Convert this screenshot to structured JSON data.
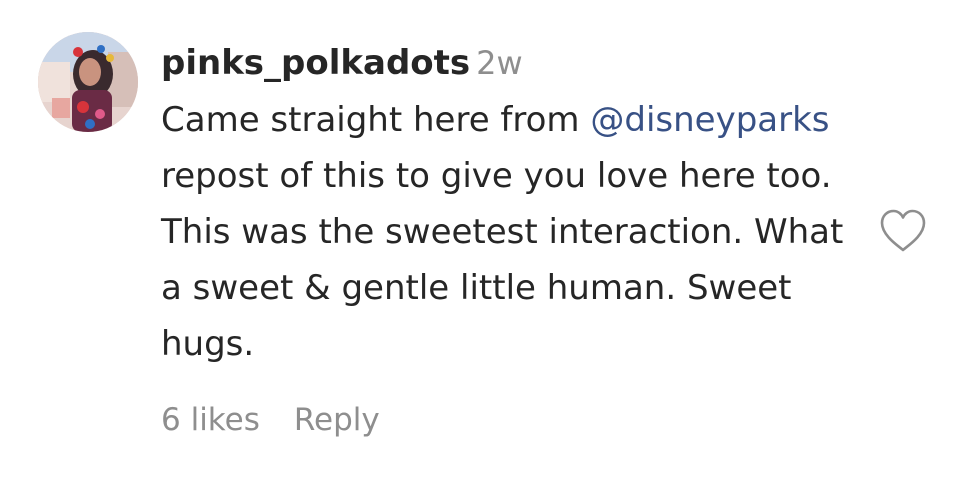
{
  "comment": {
    "username": "pinks_polkadots",
    "timestamp": "2w",
    "text_before_mention": "Came straight here from ",
    "mention": "@disneyparks",
    "text_after_mention": " repost of this to give you love here too. This was the sweetest interaction. What a sweet & gentle little human. Sweet hugs.",
    "likes_label": "6 likes",
    "reply_label": "Reply",
    "like_icon": "heart-outline-icon",
    "avatar_icon": "profile-photo"
  },
  "colors": {
    "text": "#262626",
    "muted": "#8e8e8e",
    "mention": "#385185",
    "background": "#ffffff"
  }
}
